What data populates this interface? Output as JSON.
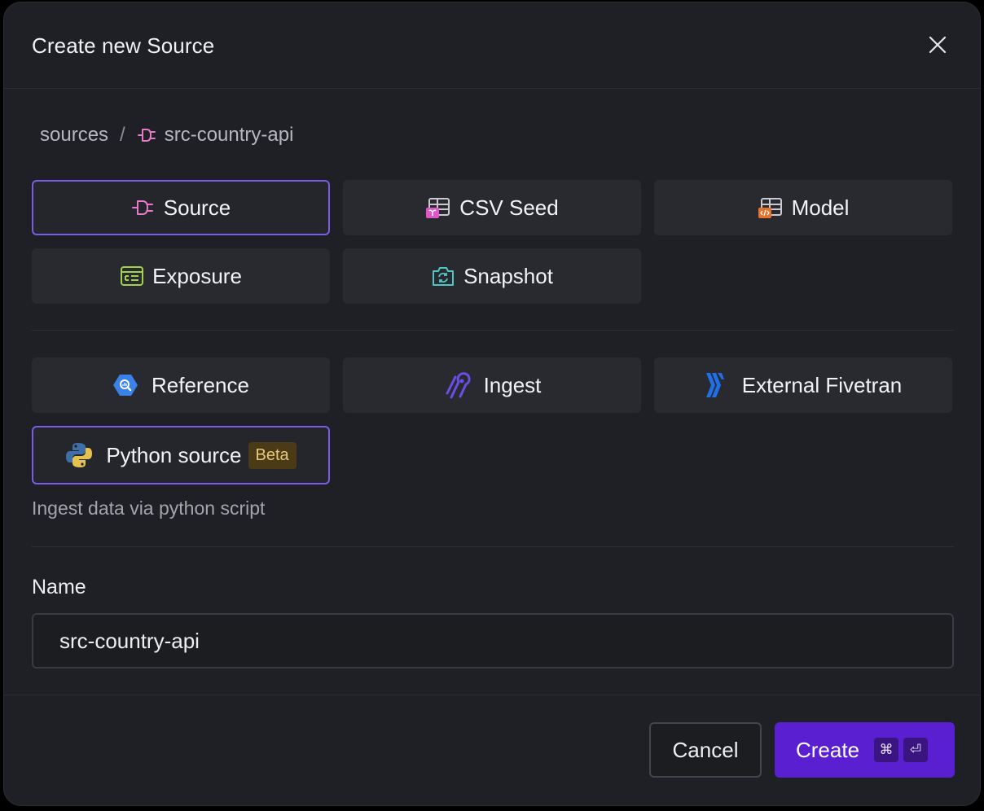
{
  "dialog": {
    "title": "Create new Source",
    "close_icon": "close-icon"
  },
  "breadcrumb": {
    "root": "sources",
    "separator": "/",
    "current": "src-country-api",
    "current_icon": "plug-icon"
  },
  "tiles": {
    "source": {
      "label": "Source",
      "icon": "plug-icon",
      "selected": true
    },
    "csv_seed": {
      "label": "CSV Seed",
      "icon": "csv-seed-icon"
    },
    "model": {
      "label": "Model",
      "icon": "model-icon"
    },
    "exposure": {
      "label": "Exposure",
      "icon": "exposure-icon"
    },
    "snapshot": {
      "label": "Snapshot",
      "icon": "snapshot-icon"
    },
    "reference": {
      "label": "Reference",
      "icon": "bigquery-icon"
    },
    "ingest": {
      "label": "Ingest",
      "icon": "airbyte-icon"
    },
    "external_fivetran": {
      "label": "External Fivetran",
      "icon": "fivetran-icon"
    },
    "python_source": {
      "label": "Python source",
      "badge": "Beta",
      "icon": "python-icon",
      "selected": true
    }
  },
  "description": "Ingest data via python script",
  "form": {
    "name_label": "Name",
    "name_value": "src-country-api"
  },
  "footer": {
    "cancel_label": "Cancel",
    "create_label": "Create",
    "shortcut_cmd": "⌘",
    "shortcut_enter": "⏎"
  },
  "colors": {
    "accent": "#7b5ce6",
    "primary_button": "#5a1fd1",
    "source_icon": "#e879c9",
    "beta_text": "#e7c77a"
  }
}
